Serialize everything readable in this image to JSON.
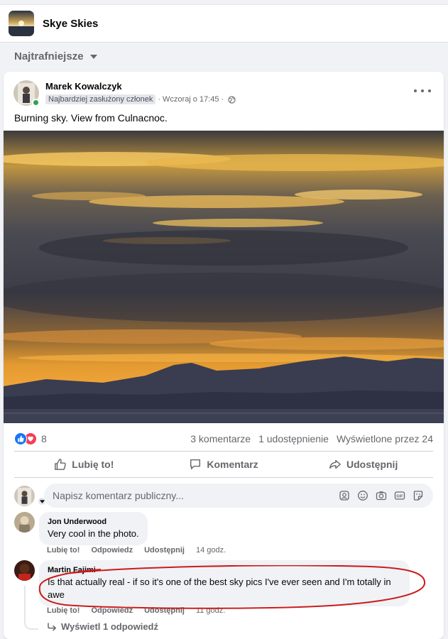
{
  "group": {
    "name": "Skye Skies"
  },
  "sort": {
    "label": "Najtrafniejsze"
  },
  "post": {
    "author": "Marek Kowalczyk",
    "badge": "Najbardziej zasłużony członek",
    "time": "Wczoraj o 17:45",
    "text": "Burning sky. View from Culnacnoc.",
    "reactions_count": "8",
    "comments_count": "3 komentarze",
    "shares_count": "1 udostępnienie",
    "views": "Wyświetlone przez 24"
  },
  "actions": {
    "like": "Lubię to!",
    "comment": "Komentarz",
    "share": "Udostępnij"
  },
  "composer": {
    "placeholder": "Napisz komentarz publiczny..."
  },
  "comments": [
    {
      "name": "Jon Underwood",
      "text": "Very cool in the photo.",
      "like": "Lubię to!",
      "reply": "Odpowiedz",
      "share": "Udostępnij",
      "time": "14 godz."
    },
    {
      "name": "Martin Fajimi",
      "text_line1": "Is that actually real - if so it's one of the best sky pics I've ever seen and I'm totally in",
      "text_line2": "awe",
      "like": "Lubię to!",
      "reply": "Odpowiedz",
      "share": "Udostępnij",
      "time": "11 godz."
    }
  ],
  "view_replies": "Wyświetl 1 odpowiedź",
  "colors": {
    "accent": "#1877f2",
    "love": "#f33e58",
    "online": "#31a24c",
    "annotation": "#cc1b1b"
  }
}
